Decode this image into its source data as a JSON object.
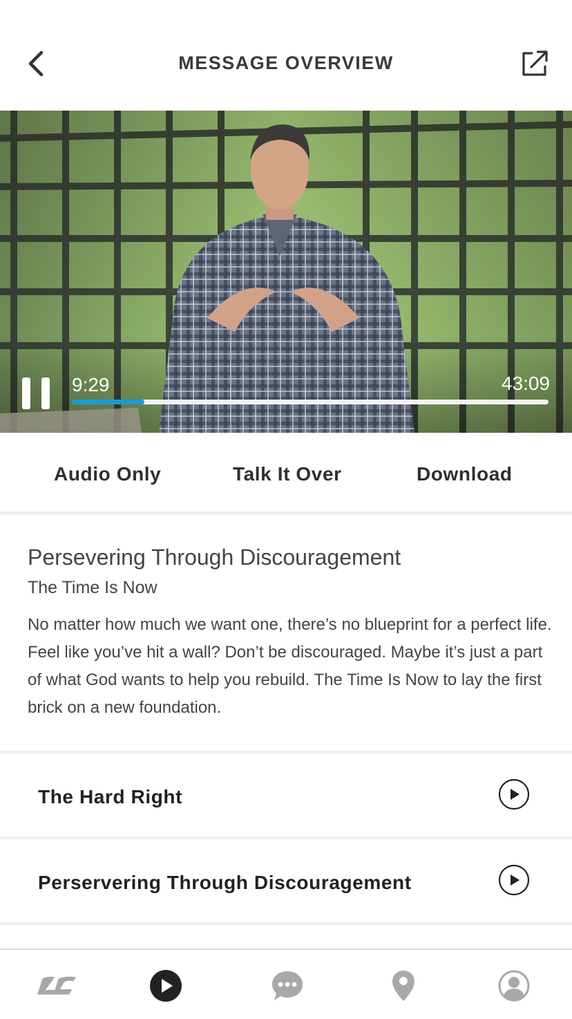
{
  "header": {
    "title": "MESSAGE OVERVIEW",
    "back_icon": "chevron-left-icon",
    "share_icon": "external-share-icon"
  },
  "player": {
    "state": "playing",
    "current_time": "9:29",
    "total_time": "43:09",
    "progress_fraction": 0.152,
    "progress_color": "#1b9bd7"
  },
  "actions": {
    "audio_only": "Audio Only",
    "talk_it_over": "Talk It Over",
    "download": "Download"
  },
  "message": {
    "title": "Persevering Through Discouragement",
    "series": "The Time Is Now",
    "description": "No matter how much we want one, there’s no blueprint for a perfect life. Feel like you’ve hit a wall? Don’t be discouraged. Maybe it’s just a part of what God wants to help you rebuild. The Time Is Now to lay the first brick on a new foundation."
  },
  "related": [
    {
      "label": "The Hard Right"
    },
    {
      "label": "Perservering Through Discouragement"
    }
  ],
  "tabbar": {
    "tabs": [
      {
        "name": "home",
        "icon": "lc-logo-icon"
      },
      {
        "name": "watch",
        "icon": "play-icon",
        "active": true
      },
      {
        "name": "chat",
        "icon": "chat-bubble-icon"
      },
      {
        "name": "locations",
        "icon": "location-pin-icon"
      },
      {
        "name": "profile",
        "icon": "user-profile-icon"
      }
    ]
  }
}
